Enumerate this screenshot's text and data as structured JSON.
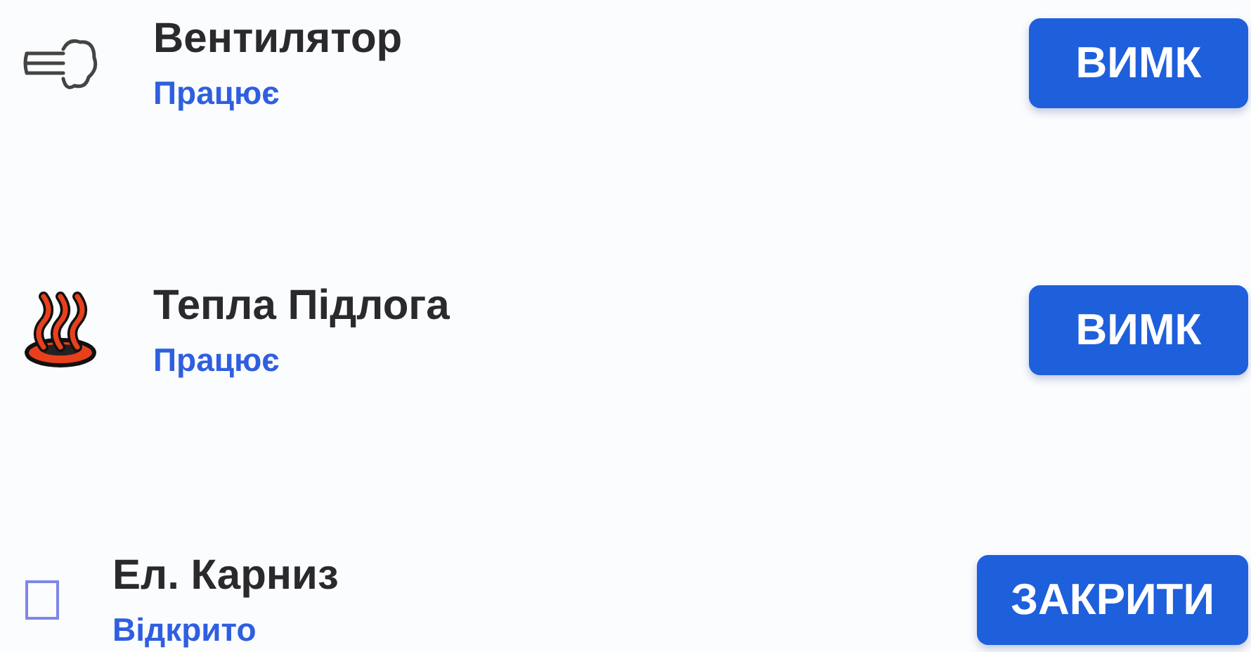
{
  "devices": [
    {
      "kind": "fan",
      "name": "Вентилятор",
      "status": "Працює",
      "action": "ВИМК"
    },
    {
      "kind": "heat",
      "name": "Тепла Підлога",
      "status": "Працює",
      "action": "ВИМК"
    },
    {
      "kind": "curtain",
      "name": "Ел. Карниз",
      "status": "Відкрито",
      "action": "ЗАКРИТИ"
    }
  ]
}
